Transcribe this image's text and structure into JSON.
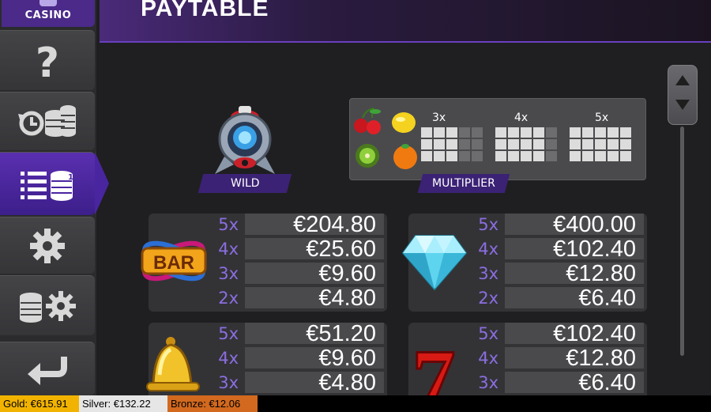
{
  "logo": {
    "text": "CASINO"
  },
  "header": {
    "title": "PAYTABLE"
  },
  "sidebar": {
    "items": [
      {
        "name": "help",
        "icon": "question-icon"
      },
      {
        "name": "history",
        "icon": "history-coins-icon"
      },
      {
        "name": "paytable",
        "icon": "paytable-list-icon",
        "active": true
      },
      {
        "name": "settings",
        "icon": "gear-icon"
      },
      {
        "name": "bet-settings",
        "icon": "coins-gear-icon"
      },
      {
        "name": "back",
        "icon": "back-arrow-icon"
      }
    ]
  },
  "wild": {
    "label": "WILD"
  },
  "multiplier": {
    "label": "MULTIPLIER",
    "levels": [
      "3x",
      "4x",
      "5x"
    ]
  },
  "paytables": [
    {
      "symbol": "bar",
      "rows": [
        {
          "count": "5x",
          "value": "€204.80"
        },
        {
          "count": "4x",
          "value": "€25.60"
        },
        {
          "count": "3x",
          "value": "€9.60"
        },
        {
          "count": "2x",
          "value": "€4.80"
        }
      ]
    },
    {
      "symbol": "diamond",
      "rows": [
        {
          "count": "5x",
          "value": "€400.00"
        },
        {
          "count": "4x",
          "value": "€102.40"
        },
        {
          "count": "3x",
          "value": "€12.80"
        },
        {
          "count": "2x",
          "value": "€6.40"
        }
      ]
    },
    {
      "symbol": "bell",
      "rows": [
        {
          "count": "5x",
          "value": "€51.20"
        },
        {
          "count": "4x",
          "value": "€9.60"
        },
        {
          "count": "3x",
          "value": "€4.80"
        }
      ]
    },
    {
      "symbol": "seven",
      "rows": [
        {
          "count": "5x",
          "value": "€102.40"
        },
        {
          "count": "4x",
          "value": "€12.80"
        },
        {
          "count": "3x",
          "value": "€6.40"
        }
      ]
    }
  ],
  "symbols": {
    "bar_text": "BAR",
    "seven_text": "7"
  },
  "status": {
    "gold": "Gold: €615.91",
    "silver": "Silver: €132.22",
    "bronze": "Bronze: €12.06"
  },
  "colors": {
    "accent": "#5a2fb0",
    "gold": "#f2b300",
    "silver": "#e6e6e6",
    "bronze": "#d2691e"
  }
}
